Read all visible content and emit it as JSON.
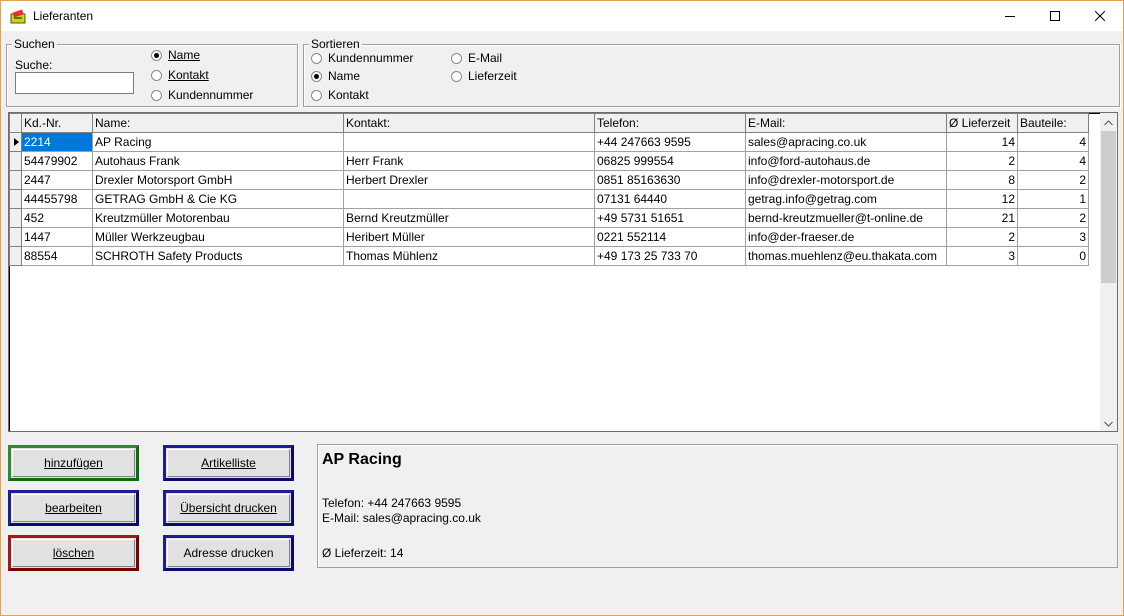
{
  "window": {
    "title": "Lieferanten"
  },
  "search": {
    "group_label": "Suchen",
    "field_label": "Suche:",
    "value": "",
    "options": [
      {
        "label": "Name",
        "selected": true
      },
      {
        "label": "Kontakt",
        "selected": false
      },
      {
        "label": "Kundennummer",
        "selected": false
      }
    ]
  },
  "sort": {
    "group_label": "Sortieren",
    "options": [
      {
        "label": "Kundennummer",
        "selected": false
      },
      {
        "label": "Name",
        "selected": true
      },
      {
        "label": "Kontakt",
        "selected": false
      },
      {
        "label": "E-Mail",
        "selected": false
      },
      {
        "label": "Lieferzeit",
        "selected": false
      }
    ]
  },
  "table": {
    "columns": [
      "Kd.-Nr.",
      "Name:",
      "Kontakt:",
      "Telefon:",
      "E-Mail:",
      "Ø Lieferzeit",
      "Bauteile:"
    ],
    "rows": [
      [
        "2214",
        "AP Racing",
        "",
        "+44 247663 9595",
        "sales@apracing.co.uk",
        "14",
        "4"
      ],
      [
        "54479902",
        "Autohaus Frank",
        "Herr Frank",
        "06825 999554",
        "info@ford-autohaus.de",
        "2",
        "4"
      ],
      [
        "2447",
        "Drexler Motorsport GmbH",
        "Herbert Drexler",
        "0851 85163630",
        "info@drexler-motorsport.de",
        "8",
        "2"
      ],
      [
        "44455798",
        "GETRAG GmbH & Cie KG",
        "",
        "07131 64440",
        "getrag.info@getrag.com",
        "12",
        "1"
      ],
      [
        "452",
        "Kreutzmüller Motorenbau",
        "Bernd Kreutzmüller",
        "+49 5731 51651",
        "bernd-kreutzmueller@t-online.de",
        "21",
        "2"
      ],
      [
        "1447",
        "Müller Werkzeugbau",
        "Heribert Müller",
        "0221 552114",
        "info@der-fraeser.de",
        "2",
        "3"
      ],
      [
        "88554",
        "SCHROTH Safety Products",
        "Thomas Mühlenz",
        "+49 173 25 733 70",
        "thomas.muehlenz@eu.thakata.com",
        "3",
        "0"
      ]
    ],
    "selected_row": 0
  },
  "buttons": {
    "add": "hinzufügen",
    "edit": "bearbeiten",
    "delete": "löschen",
    "article_list": "Artikelliste",
    "print_overview": "Übersicht drucken",
    "print_address": "Adresse drucken"
  },
  "detail": {
    "name": "AP Racing",
    "phone_label": "Telefon:",
    "phone": "+44 247663 9595",
    "email_label": "E-Mail:",
    "email": "sales@apracing.co.uk",
    "delivery_label": "Ø Lieferzeit:",
    "delivery": "14"
  },
  "colors": {
    "selection": "#0078d7",
    "button_green": "#0c6d0c",
    "button_blue": "#0a0a6e",
    "button_red": "#7a0000",
    "window_border": "#e8a04a"
  },
  "icons": {
    "app": "app-icon",
    "minimize": "minimize-icon",
    "maximize": "maximize-icon",
    "close": "close-icon"
  }
}
